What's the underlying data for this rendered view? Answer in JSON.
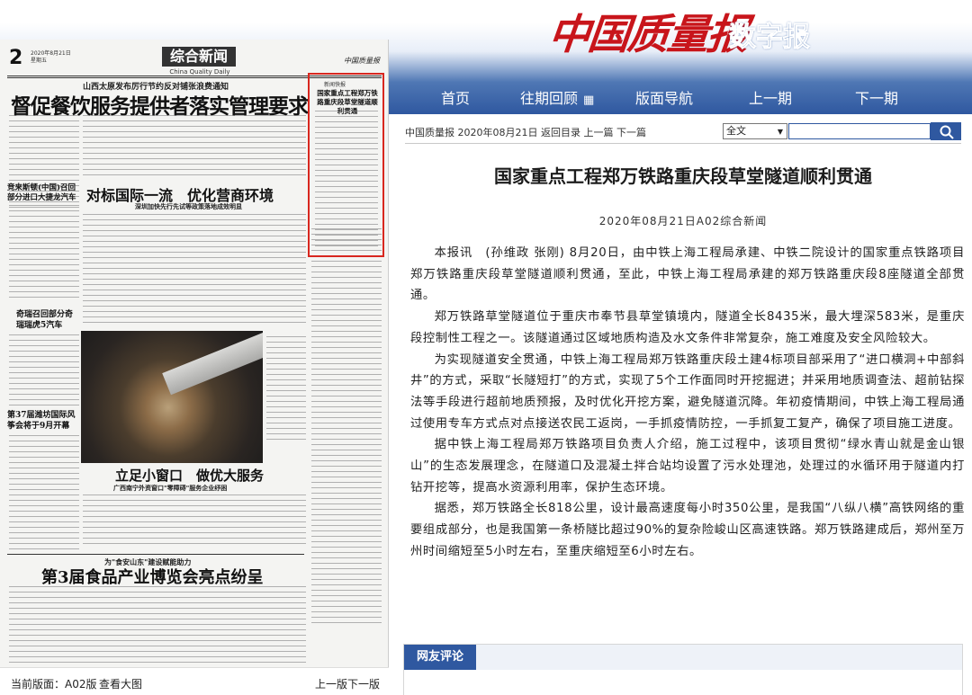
{
  "site": {
    "logo_text": "中国质量报",
    "logo_sub": "数字报",
    "nav": [
      {
        "label": "首页"
      },
      {
        "label": "往期回顾",
        "icon": "calendar-icon"
      },
      {
        "label": "版面导航"
      },
      {
        "label": "上一期"
      },
      {
        "label": "下一期"
      }
    ]
  },
  "paper_page": {
    "page_number": "2",
    "date_line": "2020年8月21日",
    "weekday": "星期五",
    "section": "综合新闻",
    "section_en": "China Quality Daily",
    "masthead": "中国质量报",
    "kicker1": "山西太原发布厉行节约反对铺张浪费通知",
    "headline1": "督促餐饮服务提供者落实管理要求",
    "headline2": "对标国际一流　优化营商环境",
    "headline2_kicker": "深圳加快先行先试等政策落地成效明显",
    "side1": "竞来斯顿(中国)召回部分进口大捷龙汽车",
    "side2": "奇瑞召回部分奇瑞瑞虎5汽车",
    "side3": "第37届潍坊国际风筝会将于9月开幕",
    "headline3": "立足小窗口　做优大服务",
    "headline3_kicker": "广西南宁外资窗口\"零障碍\"服务企业纾困",
    "kicker4": "为\"食安山东\"建设赋能助力",
    "headline4": "第3届食品产业博览会亮点纷呈",
    "highlight_kicker": "新闻快报",
    "highlight_title": "国家重点工程郑万铁路重庆段草堂隧道顺利贯通",
    "pager_current_label": "当前版面：",
    "pager_current": "A02版",
    "pager_view": "查看大图",
    "pager_prev": "上一版",
    "pager_next": "下一版"
  },
  "crumb": {
    "paper": "中国质量报",
    "date": "2020年08月21日",
    "back": "返回目录",
    "prev": "上一篇",
    "next": "下一篇"
  },
  "search": {
    "scope": "全文",
    "placeholder": ""
  },
  "article": {
    "title": "国家重点工程郑万铁路重庆段草堂隧道顺利贯通",
    "meta": "2020年08月21日A02综合新闻",
    "paragraphs": [
      "本报讯　(孙维政 张刚) 8月20日，由中铁上海工程局承建、中铁二院设计的国家重点铁路项目郑万铁路重庆段草堂隧道顺利贯通，至此，中铁上海工程局承建的郑万铁路重庆段8座隧道全部贯通。",
      "郑万铁路草堂隧道位于重庆市奉节县草堂镇境内，隧道全长8435米，最大埋深583米，是重庆段控制性工程之一。该隧道通过区域地质构造及水文条件非常复杂，施工难度及安全风险较大。",
      "为实现隧道安全贯通，中铁上海工程局郑万铁路重庆段土建4标项目部采用了“进口横洞+中部斜井”的方式，采取“长隧短打”的方式，实现了5个工作面同时开挖掘进；并采用地质调查法、超前钻探法等手段进行超前地质预报，及时优化开挖方案，避免隧道沉降。年初疫情期间，中铁上海工程局通过使用专车方式点对点接送农民工返岗，一手抓疫情防控，一手抓复工复产，确保了项目施工进度。",
      "据中铁上海工程局郑万铁路项目负责人介绍，施工过程中，该项目贯彻“绿水青山就是金山银山”的生态发展理念，在隧道口及混凝土拌合站均设置了污水处理池，处理过的水循环用于隧道内打钻开挖等，提高水资源利用率，保护生态环境。",
      "据悉，郑万铁路全长818公里，设计最高速度每小时350公里，是我国“八纵八横”高铁网络的重要组成部分，也是我国第一条桥隧比超过90%的复杂险峻山区高速铁路。郑万铁路建成后，郑州至万州时间缩短至5小时左右，至重庆缩短至6小时左右。"
    ]
  },
  "comments": {
    "label": "网友评论"
  },
  "colors": {
    "brand_red": "#c8151b",
    "nav_blue": "#2f58a0",
    "highlight_red": "#d8271f"
  }
}
